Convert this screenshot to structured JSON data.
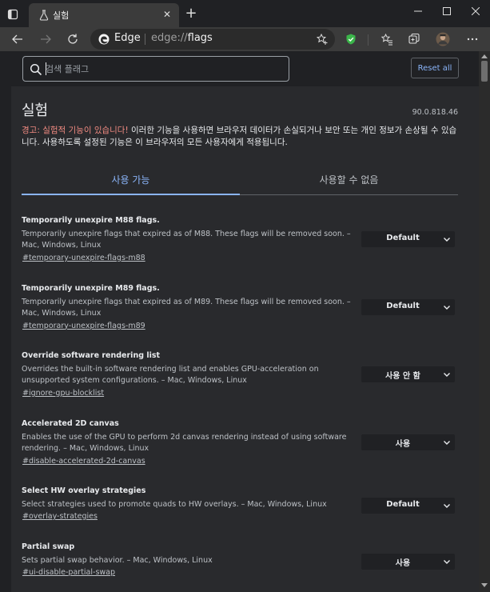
{
  "browser": {
    "tab_title": "실험",
    "omnibox_brand": "Edge",
    "url_scheme": "edge://",
    "url_path": "flags"
  },
  "header": {
    "search_placeholder": "검색 플래그",
    "reset_label": "Reset all"
  },
  "page": {
    "title": "실험",
    "version": "90.0.818.46",
    "warning_prefix": "경고: 실험적 기능이 있습니다!",
    "warning_text": " 이러한 기능을 사용하면 브라우저 데이터가 손실되거나 보안 또는 개인 정보가 손상될 수 있습니다. 사용하도록 설정된 기능은 이 브라우저의 모든 사용자에게 적용됩니다."
  },
  "tabs": {
    "available": "사용 가능",
    "unavailable": "사용할 수 없음"
  },
  "flags": [
    {
      "name": "Temporarily unexpire M88 flags.",
      "description": "Temporarily unexpire flags that expired as of M88. These flags will be removed soon. – Mac, Windows, Linux",
      "link": "#temporary-unexpire-flags-m88",
      "value": "Default"
    },
    {
      "name": "Temporarily unexpire M89 flags.",
      "description": "Temporarily unexpire flags that expired as of M89. These flags will be removed soon. – Mac, Windows, Linux",
      "link": "#temporary-unexpire-flags-m89",
      "value": "Default"
    },
    {
      "name": "Override software rendering list",
      "description": "Overrides the built-in software rendering list and enables GPU-acceleration on unsupported system configurations. – Mac, Windows, Linux",
      "link": "#ignore-gpu-blocklist",
      "value": "사용 안 함"
    },
    {
      "name": "Accelerated 2D canvas",
      "description": "Enables the use of the GPU to perform 2d canvas rendering instead of using software rendering. – Mac, Windows, Linux",
      "link": "#disable-accelerated-2d-canvas",
      "value": "사용"
    },
    {
      "name": "Select HW overlay strategies",
      "description": "Select strategies used to promote quads to HW overlays. – Mac, Windows, Linux",
      "link": "#overlay-strategies",
      "value": "Default"
    },
    {
      "name": "Partial swap",
      "description": "Sets partial swap behavior. – Mac, Windows, Linux",
      "link": "#ui-disable-partial-swap",
      "value": "사용"
    }
  ]
}
